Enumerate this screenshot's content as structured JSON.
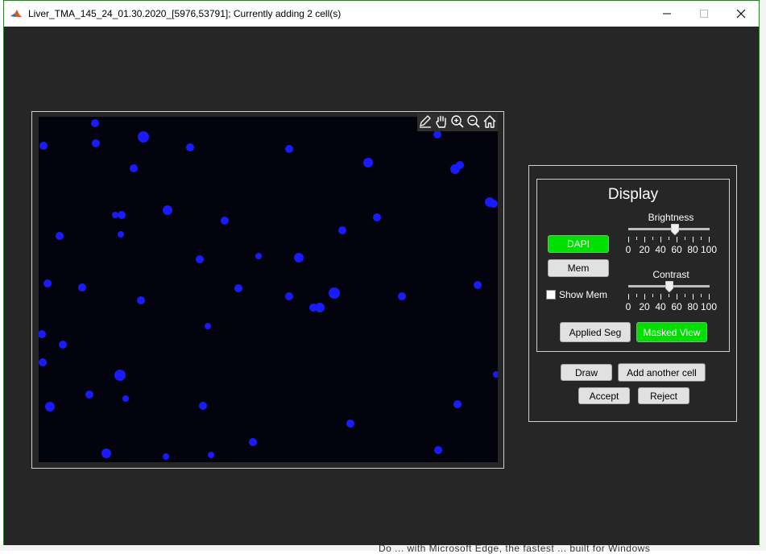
{
  "window": {
    "title": "Liver_TMA_145_24_01.30.2020_[5976,53791]; Currently adding 2 cell(s)",
    "icon": "matlab-logo-icon",
    "controls": [
      "minimize-icon",
      "maximize-icon",
      "close-icon"
    ]
  },
  "image_toolbar": {
    "tools": [
      {
        "name": "edit-brush-icon"
      },
      {
        "name": "pan-hand-icon"
      },
      {
        "name": "zoom-in-icon"
      },
      {
        "name": "zoom-out-icon"
      },
      {
        "name": "home-icon"
      }
    ]
  },
  "display": {
    "title": "Display",
    "dapi_label": "DAPI",
    "mem_label": "Mem",
    "show_mem_label": "Show Mem",
    "show_mem_checked": false,
    "brightness": {
      "label": "Brightness",
      "value": 57,
      "ticks": [
        "0",
        "20",
        "40",
        "60",
        "80",
        "100"
      ]
    },
    "contrast": {
      "label": "Contrast",
      "value": 50,
      "ticks": [
        "0",
        "20",
        "40",
        "60",
        "80",
        "100"
      ]
    },
    "applied_seg_label": "Applied Seg",
    "masked_view_label": "Masked View"
  },
  "actions": {
    "draw_label": "Draw",
    "add_another_label": "Add another cell",
    "accept_label": "Accept",
    "reject_label": "Reject"
  },
  "colors": {
    "window_bg": "#262626",
    "active_green": "#00e000",
    "nucleus_blue": "#1a1aff",
    "image_bg": "#03030d"
  },
  "background_text": "Do ... with Microsoft Edge, the fastest ... built for Windows"
}
